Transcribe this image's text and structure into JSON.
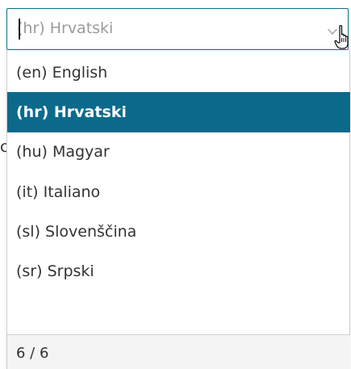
{
  "select": {
    "value": "(hr) Hrvatski"
  },
  "background": {
    "partial_text": "c"
  },
  "dropdown": {
    "options": [
      {
        "label": "(en) English",
        "selected": false
      },
      {
        "label": "(hr) Hrvatski",
        "selected": true
      },
      {
        "label": "(hu) Magyar",
        "selected": false
      },
      {
        "label": "(it) Italiano",
        "selected": false
      },
      {
        "label": "(sl) Slovenščina",
        "selected": false
      },
      {
        "label": "(sr) Srpski",
        "selected": false
      }
    ],
    "footer": "6 / 6"
  },
  "colors": {
    "accent": "#0b6a8b",
    "border": "#0a6e8a",
    "placeholder_text": "#9a9a9a"
  },
  "icons": {
    "dropdown_toggle": "chevron-down-icon",
    "mouse_cursor": "hand-pointer-icon"
  }
}
